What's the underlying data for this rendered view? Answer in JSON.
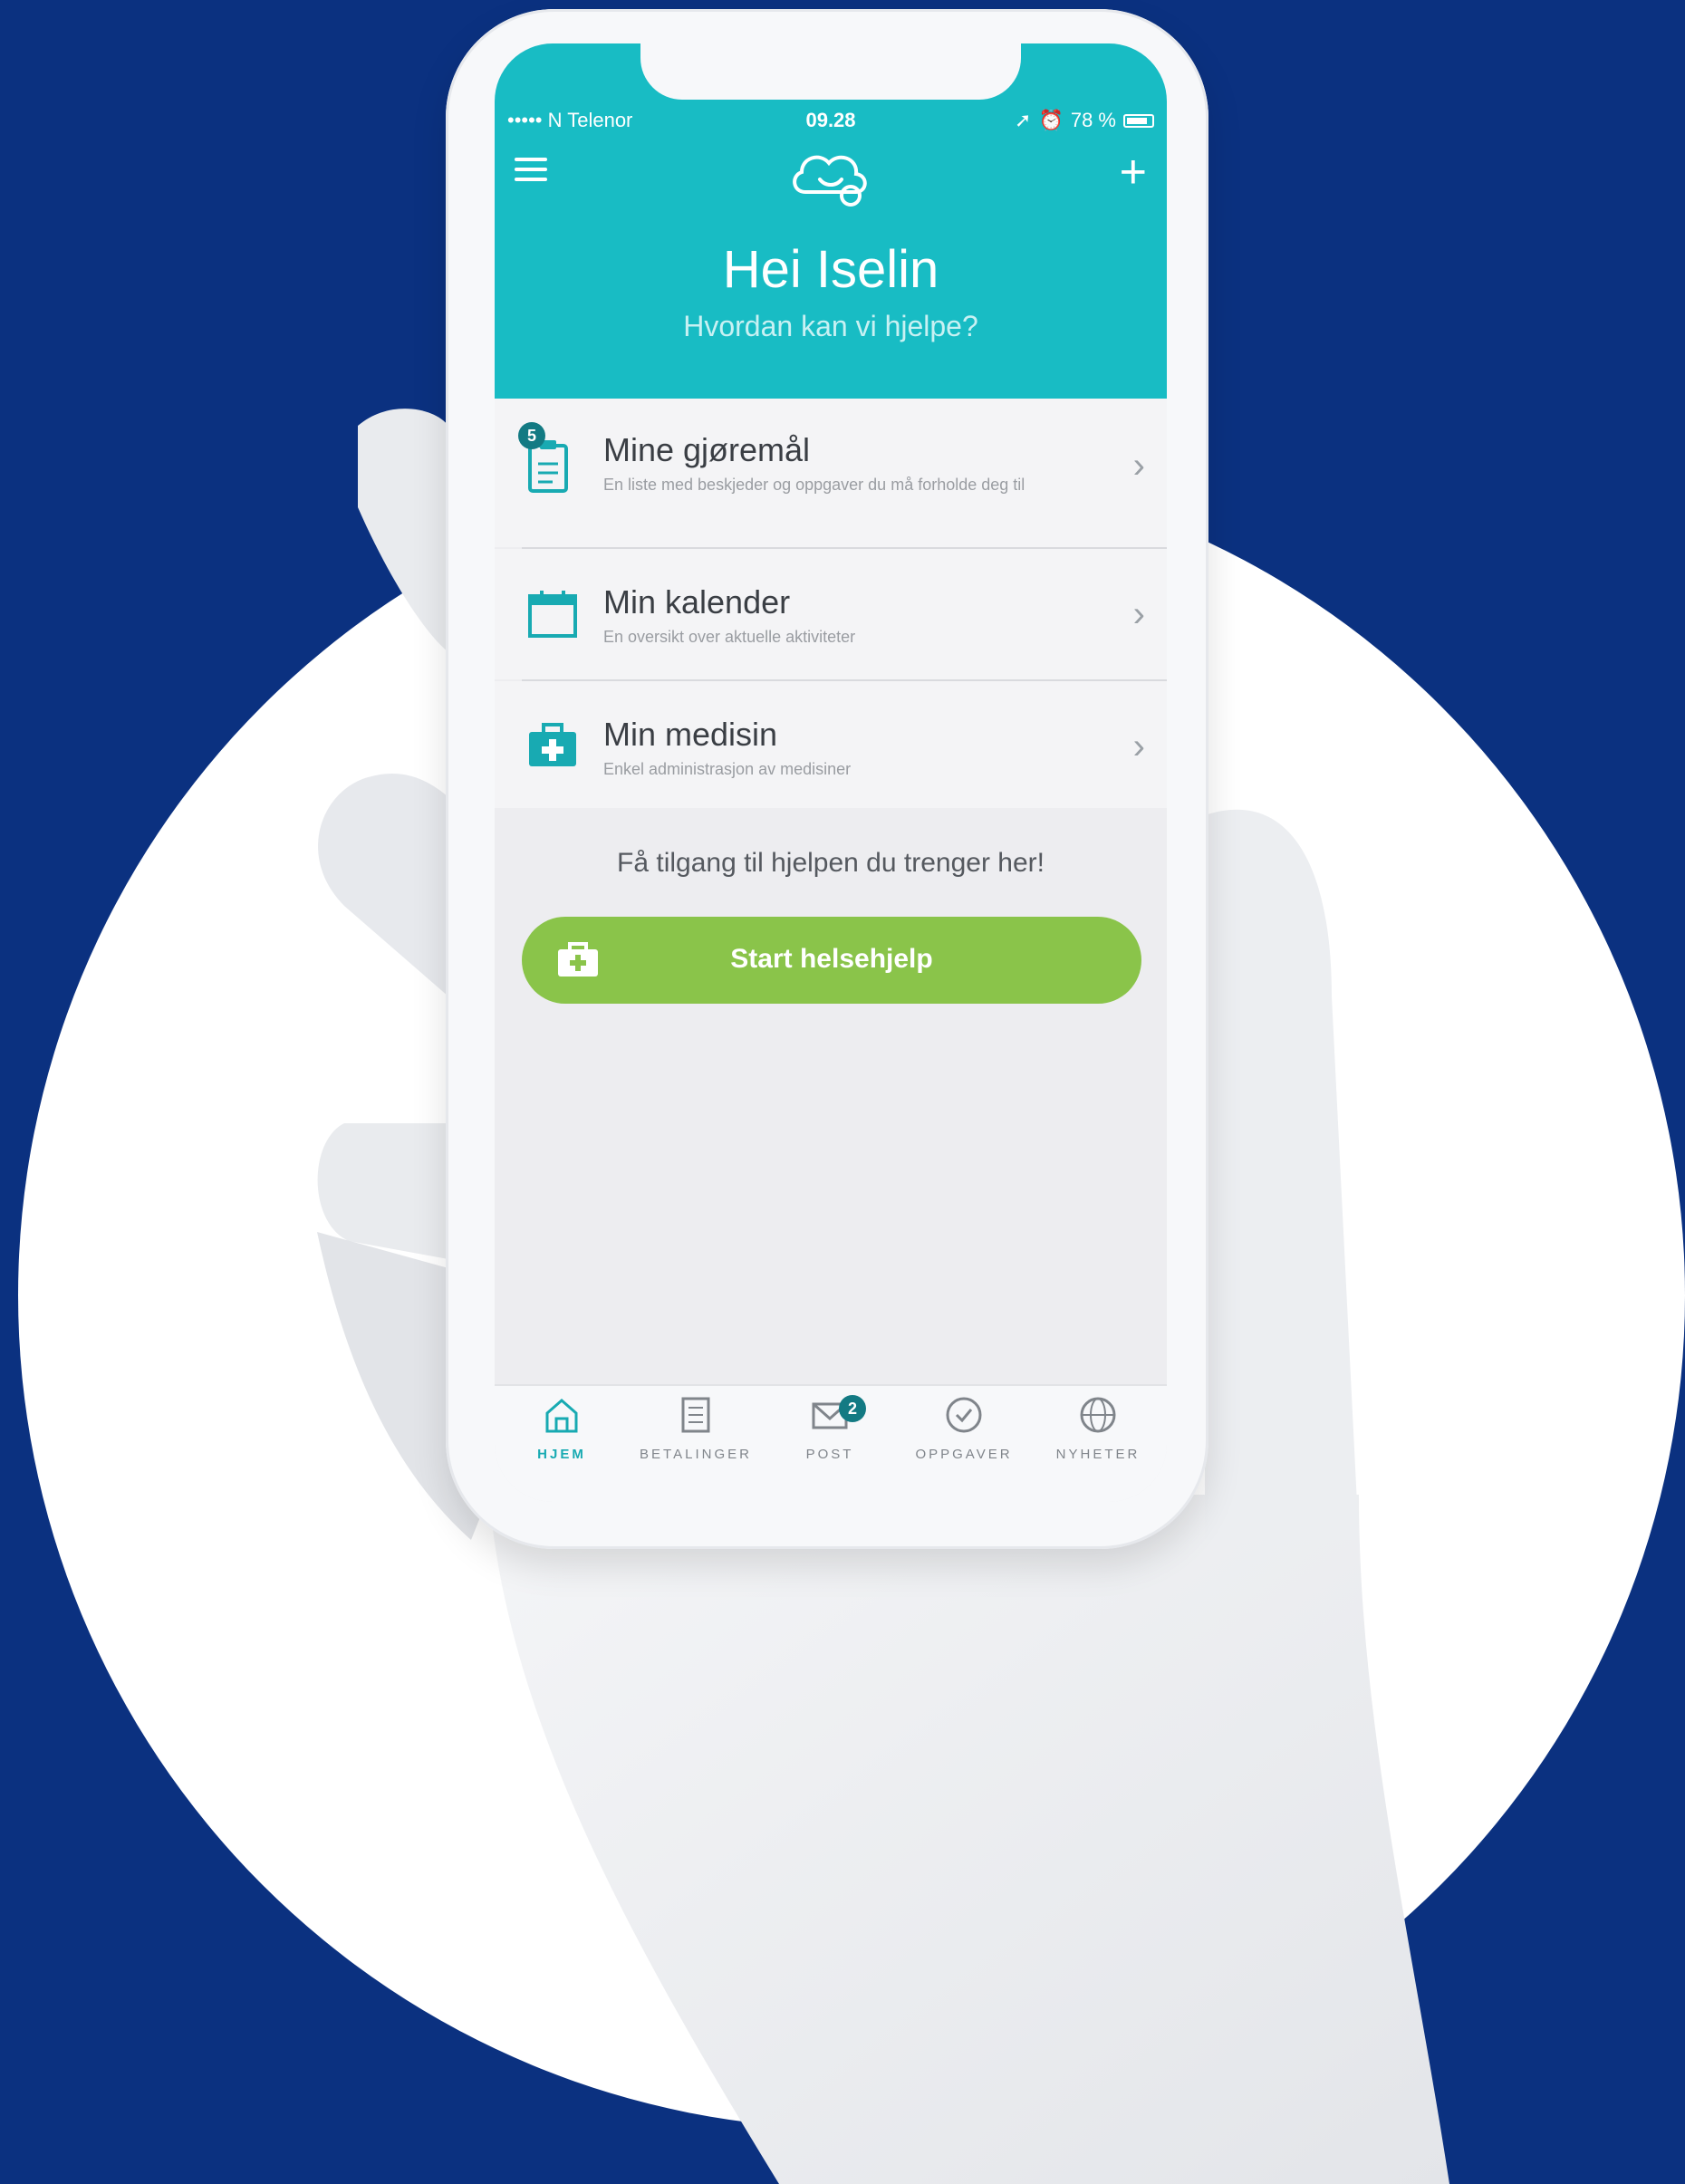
{
  "status_bar": {
    "carrier": "••••• N Telenor",
    "time": "09.28",
    "battery": "78 %"
  },
  "header": {
    "greeting": "Hei Iselin",
    "subtitle": "Hvordan kan vi hjelpe?",
    "plus_label": "+"
  },
  "menu": [
    {
      "title": "Mine gjøremål",
      "desc": "En liste med beskjeder og oppgaver du må forholde deg til",
      "badge": "5"
    },
    {
      "title": "Min kalender",
      "desc": "En oversikt over aktuelle aktiviteter"
    },
    {
      "title": "Min medisin",
      "desc": "Enkel administrasjon av medisiner"
    }
  ],
  "promo_text": "Få tilgang til hjelpen du trenger her!",
  "cta_label": "Start helsehjelp",
  "tabs": [
    {
      "label": "HJEM",
      "active": true
    },
    {
      "label": "BETALINGER"
    },
    {
      "label": "POST",
      "badge": "2"
    },
    {
      "label": "OPPGAVER"
    },
    {
      "label": "NYHETER"
    }
  ],
  "colors": {
    "background": "#0b3180",
    "header": "#18bcc4",
    "cta": "#8ac44a",
    "badge": "#137a83",
    "active_tab": "#18aab2"
  }
}
